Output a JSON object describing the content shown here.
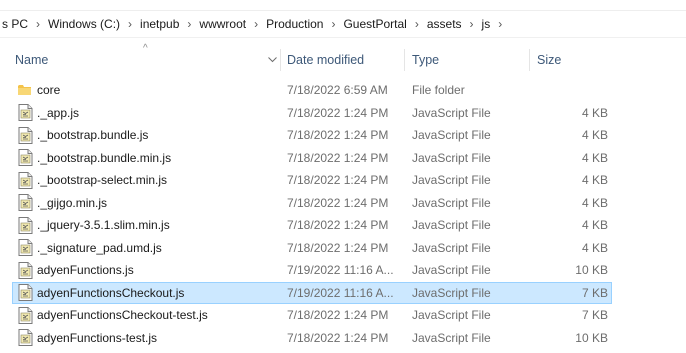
{
  "breadcrumb": [
    "s PC",
    "Windows (C:)",
    "inetpub",
    "wwwroot",
    "Production",
    "GuestPortal",
    "assets",
    "js"
  ],
  "columns": {
    "name": "Name",
    "date": "Date modified",
    "type": "Type",
    "size": "Size"
  },
  "sort_indicator": "^",
  "rows": [
    {
      "name": "core",
      "date": "7/18/2022 6:59 AM",
      "type": "File folder",
      "size": "",
      "icon": "folder-icon"
    },
    {
      "name": "._app.js",
      "date": "7/18/2022 1:24 PM",
      "type": "JavaScript File",
      "size": "4 KB",
      "icon": "js-file-icon"
    },
    {
      "name": "._bootstrap.bundle.js",
      "date": "7/18/2022 1:24 PM",
      "type": "JavaScript File",
      "size": "4 KB",
      "icon": "js-file-icon"
    },
    {
      "name": "._bootstrap.bundle.min.js",
      "date": "7/18/2022 1:24 PM",
      "type": "JavaScript File",
      "size": "4 KB",
      "icon": "js-file-icon"
    },
    {
      "name": "._bootstrap-select.min.js",
      "date": "7/18/2022 1:24 PM",
      "type": "JavaScript File",
      "size": "4 KB",
      "icon": "js-file-icon"
    },
    {
      "name": "._gijgo.min.js",
      "date": "7/18/2022 1:24 PM",
      "type": "JavaScript File",
      "size": "4 KB",
      "icon": "js-file-icon"
    },
    {
      "name": "._jquery-3.5.1.slim.min.js",
      "date": "7/18/2022 1:24 PM",
      "type": "JavaScript File",
      "size": "4 KB",
      "icon": "js-file-icon"
    },
    {
      "name": "._signature_pad.umd.js",
      "date": "7/18/2022 1:24 PM",
      "type": "JavaScript File",
      "size": "4 KB",
      "icon": "js-file-icon"
    },
    {
      "name": "adyenFunctions.js",
      "date": "7/19/2022 11:16 A...",
      "type": "JavaScript File",
      "size": "10 KB",
      "icon": "js-file-icon"
    },
    {
      "name": "adyenFunctionsCheckout.js",
      "date": "7/19/2022 11:16 A...",
      "type": "JavaScript File",
      "size": "7 KB",
      "icon": "js-file-icon",
      "selected": true
    },
    {
      "name": "adyenFunctionsCheckout-test.js",
      "date": "7/18/2022 1:24 PM",
      "type": "JavaScript File",
      "size": "7 KB",
      "icon": "js-file-icon"
    },
    {
      "name": "adyenFunctions-test.js",
      "date": "7/18/2022 1:24 PM",
      "type": "JavaScript File",
      "size": "10 KB",
      "icon": "js-file-icon"
    }
  ],
  "colors": {
    "selection": "#cce8ff",
    "selection_border": "#99d1ff",
    "header_text": "#3d5878",
    "folder": "#f4c34a"
  }
}
